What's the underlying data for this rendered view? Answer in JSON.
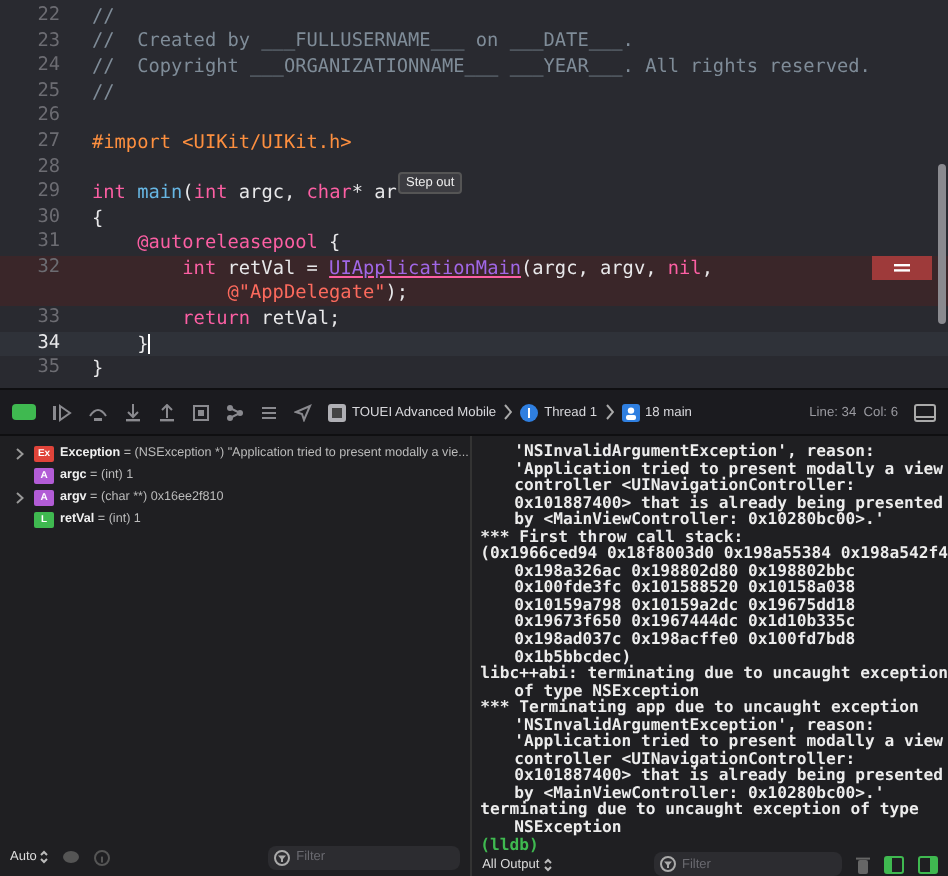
{
  "editor": {
    "lines": [
      {
        "num": "22",
        "current": false,
        "error": false,
        "tokens": [
          {
            "text": "//",
            "kind": "comment"
          }
        ]
      },
      {
        "num": "23",
        "current": false,
        "error": false,
        "tokens": [
          {
            "text": "//  Created by ___FULLUSERNAME___ on ___DATE___.",
            "kind": "comment"
          }
        ]
      },
      {
        "num": "24",
        "current": false,
        "error": false,
        "tokens": [
          {
            "text": "//  Copyright ___ORGANIZATIONNAME___ ___YEAR___. All rights reserved.",
            "kind": "comment"
          }
        ]
      },
      {
        "num": "25",
        "current": false,
        "error": false,
        "tokens": [
          {
            "text": "//",
            "kind": "comment"
          }
        ]
      },
      {
        "num": "26",
        "current": false,
        "error": false
      },
      {
        "num": "27",
        "current": false,
        "error": false,
        "tokens": [
          {
            "text": "#import",
            "kind": "preproc"
          },
          {
            "text": " <UIKit/UIKit.h>",
            "kind": "preproc"
          }
        ]
      },
      {
        "num": "28",
        "current": false,
        "error": false
      },
      {
        "num": "29",
        "current": false,
        "error": false,
        "tokens": [
          {
            "text": "int",
            "kind": "keyword"
          },
          {
            "text": " main",
            "kind": "func"
          },
          {
            "text": "(",
            "kind": "plain"
          },
          {
            "text": "int",
            "kind": "keyword"
          },
          {
            "text": " argc, ",
            "kind": "plain"
          },
          {
            "text": "char",
            "kind": "keyword"
          },
          {
            "text": "* ar",
            "kind": "plain"
          }
        ],
        "tooltip": "Step out"
      },
      {
        "num": "30",
        "current": false,
        "error": false,
        "tokens": [
          {
            "text": "{",
            "kind": "plain"
          }
        ]
      },
      {
        "num": "31",
        "current": false,
        "error": false,
        "tokens": [
          {
            "text": "    @autoreleasepool",
            "kind": "keyword"
          },
          {
            "text": " {",
            "kind": "plain"
          }
        ]
      },
      {
        "num": "32",
        "current": false,
        "error": true,
        "tokens": [
          {
            "text": "        int",
            "kind": "keyword"
          },
          {
            "text": " retVal = ",
            "kind": "plain"
          },
          {
            "text": "UIApplicationMain",
            "kind": "call"
          },
          {
            "text": "(argc, argv, ",
            "kind": "plain"
          },
          {
            "text": "nil",
            "kind": "keyword"
          },
          {
            "text": ",",
            "kind": "plain"
          }
        ],
        "wrap": [
          {
            "text": "            @\"AppDelegate\"",
            "kind": "string"
          },
          {
            "text": ");",
            "kind": "plain"
          }
        ]
      },
      {
        "num": "33",
        "current": false,
        "error": false,
        "tokens": [
          {
            "text": "        return",
            "kind": "keyword"
          },
          {
            "text": " retVal;",
            "kind": "plain"
          }
        ]
      },
      {
        "num": "34",
        "current": true,
        "error": false,
        "tokens": [
          {
            "text": "    }",
            "kind": "plain"
          }
        ]
      },
      {
        "num": "35",
        "current": false,
        "error": false,
        "tokens": [
          {
            "text": "}",
            "kind": "plain"
          }
        ]
      }
    ]
  },
  "debug_bar": {
    "breadcrumbs": [
      {
        "label": "TOUEI Advanced Mobile",
        "kind": "app"
      },
      {
        "label": "Thread 1",
        "kind": "thread"
      },
      {
        "label": "18 main",
        "kind": "frame"
      }
    ],
    "position": "Line: 34  Col: 6"
  },
  "variables": [
    {
      "expandable": true,
      "badge": "Ex",
      "color": "#e0443a",
      "name": "Exception",
      "value": " = (NSException *) \"Application tried to present modally a vie..."
    },
    {
      "expandable": false,
      "badge": "A",
      "color": "#b25cd6",
      "name": "argc",
      "value": " = (int) 1"
    },
    {
      "expandable": true,
      "badge": "A",
      "color": "#b25cd6",
      "name": "argv",
      "value": " = (char **) 0x16ee2f810"
    },
    {
      "expandable": false,
      "badge": "L",
      "color": "#3fb950",
      "name": "retVal",
      "value": " = (int) 1"
    }
  ],
  "console": {
    "lines": [
      {
        "text": "'NSInvalidArgumentException', reason:",
        "indent": true
      },
      {
        "text": "'Application tried to present modally a view",
        "indent": true
      },
      {
        "text": "controller <UINavigationController:",
        "indent": true
      },
      {
        "text": "0x101887400> that is already being presented",
        "indent": true
      },
      {
        "text": "by <MainViewController: 0x10280bc00>.'",
        "indent": true
      },
      {
        "text": "*** First throw call stack:",
        "indent": false
      },
      {
        "text": "(0x1966ced94 0x18f8003d0 0x198a55384 0x198a542f4",
        "indent": false
      },
      {
        "text": "0x198a326ac 0x198802d80 0x198802bbc",
        "indent": true
      },
      {
        "text": "0x100fde3fc 0x101588520 0x10158a038",
        "indent": true
      },
      {
        "text": "0x10159a798 0x10159a2dc 0x19675dd18",
        "indent": true
      },
      {
        "text": "0x19673f650 0x1967444dc 0x1d10b335c",
        "indent": true
      },
      {
        "text": "0x198ad037c 0x198acffe0 0x100fd7bd8",
        "indent": true
      },
      {
        "text": "0x1b5bbcdec)",
        "indent": true
      },
      {
        "text": "libc++abi: terminating due to uncaught exception",
        "indent": false
      },
      {
        "text": "of type NSException",
        "indent": true
      },
      {
        "text": "*** Terminating app due to uncaught exception",
        "indent": false
      },
      {
        "text": "'NSInvalidArgumentException', reason:",
        "indent": true
      },
      {
        "text": "'Application tried to present modally a view",
        "indent": true
      },
      {
        "text": "controller <UINavigationController:",
        "indent": true
      },
      {
        "text": "0x101887400> that is already being presented",
        "indent": true
      },
      {
        "text": "by <MainViewController: 0x10280bc00>.'",
        "indent": true
      },
      {
        "text": "terminating due to uncaught exception of type",
        "indent": false
      },
      {
        "text": "NSException",
        "indent": true
      }
    ],
    "prompt": "(lldb)"
  },
  "left_footer": {
    "scope": "Auto",
    "filter_placeholder": "Filter"
  },
  "right_footer": {
    "output": "All Output",
    "filter_placeholder": "Filter"
  }
}
